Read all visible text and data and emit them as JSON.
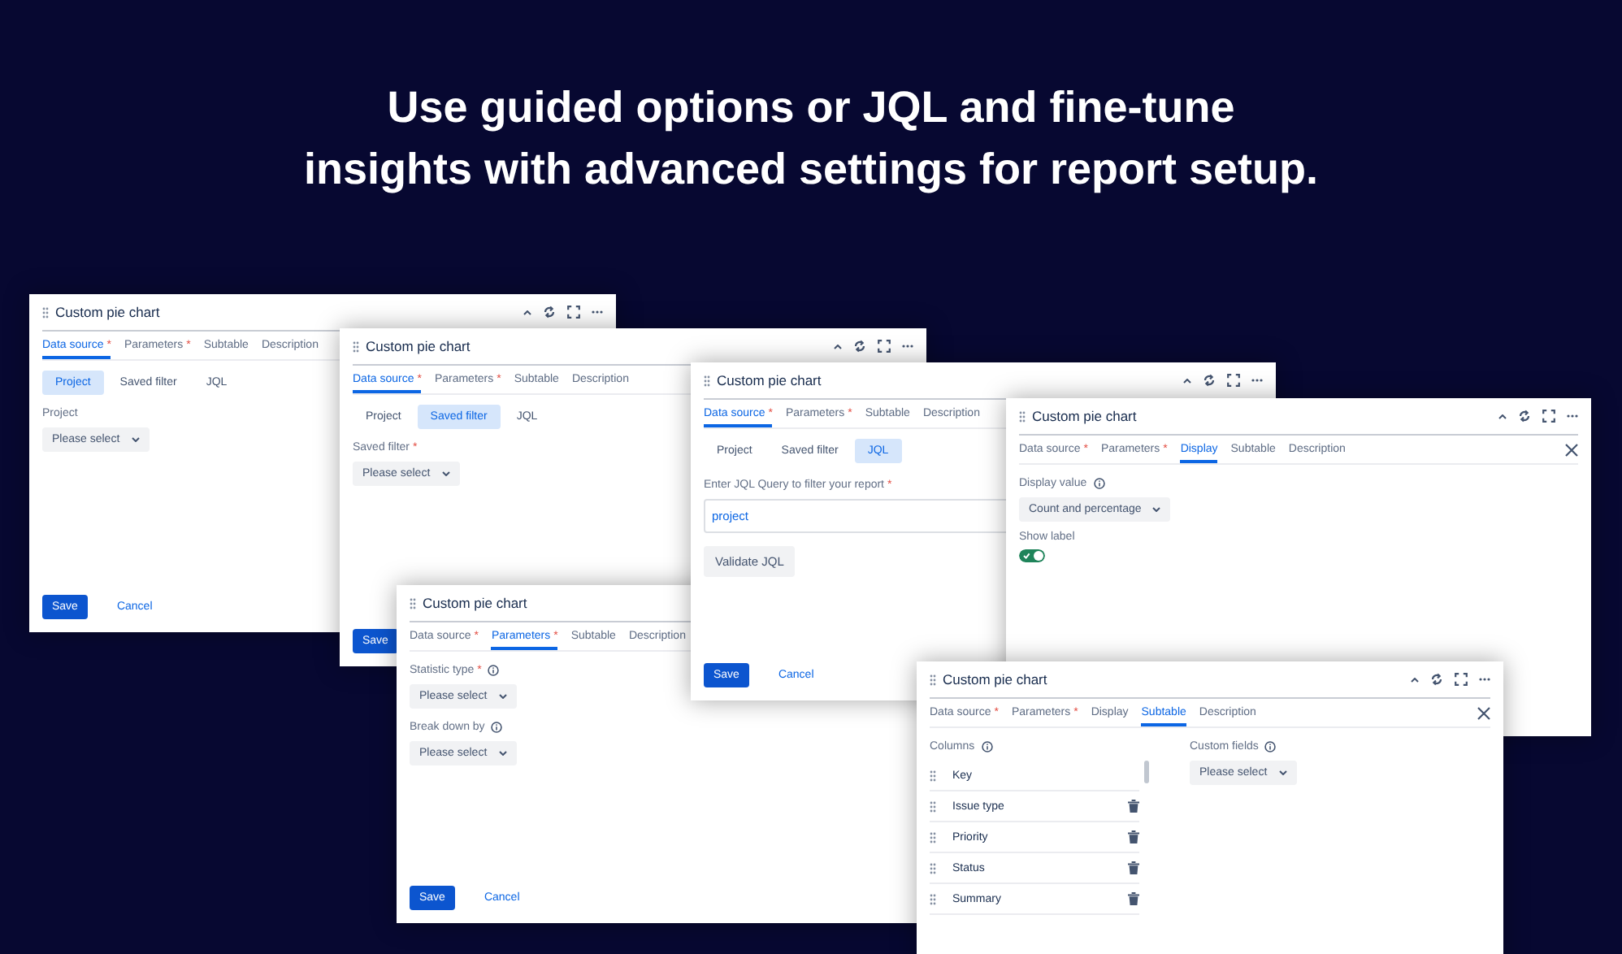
{
  "headline": [
    "Use guided options or JQL and fine-tune",
    "insights with advanced settings for report setup."
  ],
  "windows": [
    {
      "title": "Custom pie chart",
      "controls": true,
      "closable": false,
      "tabs": [
        {
          "label": "Data source",
          "mark": "*",
          "selected": true
        },
        {
          "label": "Parameters",
          "mark": "*",
          "selected": false
        },
        {
          "label": "Subtable",
          "selected": false
        },
        {
          "label": "Description",
          "selected": false
        }
      ],
      "subtabs": [
        {
          "label": "Project",
          "selected": true
        },
        {
          "label": "Saved filter",
          "selected": false
        },
        {
          "label": "JQL",
          "selected": false
        }
      ],
      "fields": [
        {
          "kind": "select",
          "label": "Project",
          "value": "Please select"
        }
      ],
      "actions": [
        {
          "kind": "primary",
          "label": "Save"
        },
        {
          "kind": "link",
          "label": "Cancel"
        }
      ]
    },
    {
      "title": "Custom pie chart",
      "controls": true,
      "closable": false,
      "tabs": [
        {
          "label": "Data source",
          "mark": "*",
          "selected": true
        },
        {
          "label": "Parameters",
          "mark": "*",
          "selected": false
        },
        {
          "label": "Subtable",
          "selected": false
        },
        {
          "label": "Description",
          "selected": false
        }
      ],
      "subtabs": [
        {
          "label": "Project",
          "selected": false
        },
        {
          "label": "Saved filter",
          "selected": true
        },
        {
          "label": "JQL",
          "selected": false
        }
      ],
      "fields": [
        {
          "kind": "select",
          "label": "Saved filter",
          "mark": "*",
          "value": "Please select"
        }
      ],
      "actions": [
        {
          "kind": "primary",
          "label": "Save"
        }
      ]
    },
    {
      "title": "Custom pie chart",
      "controls": false,
      "closable": false,
      "tabs": [
        {
          "label": "Data source",
          "mark": "*",
          "selected": false
        },
        {
          "label": "Parameters",
          "mark": "*",
          "selected": true
        },
        {
          "label": "Subtable",
          "selected": false
        },
        {
          "label": "Description",
          "selected": false
        }
      ],
      "fields": [
        {
          "kind": "select",
          "label": "Statistic type",
          "mark": "*",
          "info": true,
          "value": "Please select"
        },
        {
          "kind": "select",
          "label": "Break down by",
          "info": true,
          "value": "Please select"
        }
      ],
      "actions": [
        {
          "kind": "primary",
          "label": "Save"
        },
        {
          "kind": "link",
          "label": "Cancel"
        }
      ]
    },
    {
      "title": "Custom pie chart",
      "controls": true,
      "closable": false,
      "tabs": [
        {
          "label": "Data source",
          "mark": "*",
          "selected": true
        },
        {
          "label": "Parameters",
          "mark": "*",
          "selected": false
        },
        {
          "label": "Subtable",
          "selected": false
        },
        {
          "label": "Description",
          "selected": false
        }
      ],
      "subtabs": [
        {
          "label": "Project",
          "selected": false
        },
        {
          "label": "Saved filter",
          "selected": false
        },
        {
          "label": "JQL",
          "selected": true
        }
      ],
      "fields": [
        {
          "kind": "input",
          "label": "Enter JQL Query to filter your report",
          "mark": "*",
          "value": "project"
        },
        {
          "kind": "button",
          "label": "Validate JQL"
        }
      ],
      "actions": [
        {
          "kind": "primary",
          "label": "Save"
        },
        {
          "kind": "link",
          "label": "Cancel"
        }
      ]
    },
    {
      "title": "Custom pie chart",
      "controls": true,
      "closable": true,
      "tabs": [
        {
          "label": "Data source",
          "mark": "*",
          "selected": false
        },
        {
          "label": "Parameters",
          "mark": "*",
          "selected": false
        },
        {
          "label": "Display",
          "selected": true
        },
        {
          "label": "Subtable",
          "selected": false
        },
        {
          "label": "Description",
          "selected": false
        }
      ],
      "fields": [
        {
          "kind": "select",
          "label": "Display value",
          "info": true,
          "value": "Count and percentage"
        },
        {
          "kind": "toggle",
          "label": "Show label",
          "on": true
        }
      ]
    },
    {
      "title": "Custom pie chart",
      "controls": true,
      "closable": true,
      "tabs": [
        {
          "label": "Data source",
          "mark": "*",
          "selected": false
        },
        {
          "label": "Parameters",
          "mark": "*",
          "selected": false
        },
        {
          "label": "Display",
          "selected": false
        },
        {
          "label": "Subtable",
          "selected": true
        },
        {
          "label": "Description",
          "selected": false
        }
      ],
      "fields": [
        {
          "kind": "list",
          "label": "Columns",
          "info": true,
          "rows": [
            {
              "name": "Key",
              "removable": false
            },
            {
              "name": "Issue type",
              "removable": true
            },
            {
              "name": "Priority",
              "removable": true
            },
            {
              "name": "Status",
              "removable": true
            },
            {
              "name": "Summary",
              "removable": true
            }
          ]
        }
      ],
      "side_fields": [
        {
          "kind": "select",
          "label": "Custom fields",
          "info": true,
          "value": "Please select"
        }
      ]
    }
  ]
}
